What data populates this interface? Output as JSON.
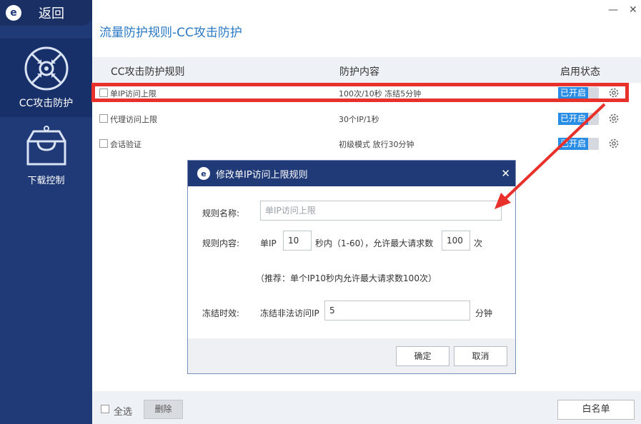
{
  "sidebar": {
    "back_label": "返回",
    "logo_letter": "e",
    "items": [
      {
        "label": "CC攻击防护",
        "icon": "crosshair-shield-icon",
        "active": true
      },
      {
        "label": "下载控制",
        "icon": "download-box-icon",
        "active": false
      }
    ]
  },
  "window": {
    "minimize": "—",
    "close": "✕"
  },
  "page": {
    "title": "流量防护规则-CC攻击防护"
  },
  "table": {
    "headers": [
      "CC攻击防护规则",
      "防护内容",
      "启用状态"
    ],
    "rows": [
      {
        "name": "单IP访问上限",
        "content": "100次/10秒  冻结5分钟",
        "status": "已开启",
        "highlighted": true
      },
      {
        "name": "代理访问上限",
        "content": "30个IP/1秒",
        "status": "已开启",
        "highlighted": false
      },
      {
        "name": "会话验证",
        "content": "初级模式 放行30分钟",
        "status": "已开启",
        "highlighted": false
      }
    ]
  },
  "bottom": {
    "select_all": "全选",
    "delete": "删除",
    "whitelist": "白名单"
  },
  "dialog": {
    "title": "修改单IP访问上限规则",
    "close": "✕",
    "name_label": "规则名称:",
    "name_placeholder": "单IP访问上限",
    "content_label": "规则内容:",
    "single_ip": "单IP",
    "seconds_value": "10",
    "seconds_text": "秒内（1-60），允许最大请求数",
    "max_requests_value": "100",
    "times_unit": "次",
    "hint": "（推荐：单个IP10秒内允许最大请求数100次）",
    "freeze_label": "冻结时效:",
    "freeze_text": "冻结非法访问IP",
    "freeze_value": "5",
    "minute_unit": "分钟",
    "confirm": "确定",
    "cancel": "取消"
  },
  "colors": {
    "sidebar": "#1f3a77",
    "accent": "#2a8de5",
    "title": "#2a78c4",
    "highlight": "#e8312b"
  }
}
